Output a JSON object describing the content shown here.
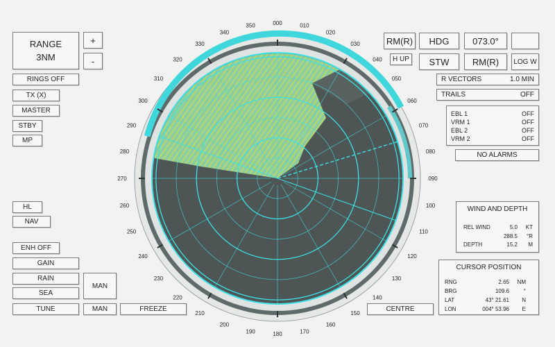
{
  "left": {
    "range_label": "RANGE",
    "range_value": "3NM",
    "plus": "+",
    "minus": "-",
    "rings": "RINGS OFF",
    "tx": "TX (X)",
    "master": "MASTER",
    "stby": "STBY",
    "mp": "MP",
    "hl": "HL",
    "nav": "NAV",
    "enh": "ENH OFF",
    "gain": "GAIN",
    "rain": "RAIN",
    "sea": "SEA",
    "tune": "TUNE",
    "man1": "MAN",
    "man2": "MAN",
    "freeze": "FREEZE"
  },
  "top_right": {
    "rm_r": "RM(R)",
    "hdg": "HDG",
    "hdg_value": "073.0°",
    "h_up": "H UP",
    "stw": "STW",
    "rm_r2": "RM(R)",
    "log_w": "LOG W"
  },
  "right": {
    "r_vectors_label": "R VECTORS",
    "r_vectors_value": "1.0 MIN",
    "trails_label": "TRAILS",
    "trails_value": "OFF",
    "markers": [
      {
        "label": "EBL 1",
        "value": "OFF"
      },
      {
        "label": "VRM 1",
        "value": "OFF"
      },
      {
        "label": "EBL 2",
        "value": "OFF"
      },
      {
        "label": "VRM 2",
        "value": "OFF"
      }
    ],
    "alarms": "NO ALARMS",
    "wind": {
      "title": "WIND AND DEPTH",
      "rel_wind_label": "REL WIND",
      "rel_wind_value": "5.0",
      "rel_wind_unit": "KT",
      "rel_wind_dir": "288.5",
      "rel_wind_dir_unit": "°R",
      "depth_label": "DEPTH",
      "depth_value": "15.2",
      "depth_unit": "M"
    },
    "cursor": {
      "title": "CURSOR POSITION",
      "rows": [
        {
          "label": "RNG",
          "value": "2.65",
          "unit": "NM"
        },
        {
          "label": "BRG",
          "value": "109.6",
          "unit": "°"
        },
        {
          "label": "LAT",
          "value": "43° 21.61",
          "unit": "N"
        },
        {
          "label": "LON",
          "value": "004° 53.96",
          "unit": "E"
        }
      ]
    },
    "centre": "CENTRE"
  },
  "radar": {
    "bearing_labels": [
      "000",
      "010",
      "020",
      "030",
      "040",
      "050",
      "060",
      "070",
      "080",
      "090",
      "100",
      "110",
      "120",
      "130",
      "140",
      "150",
      "160",
      "170",
      "180",
      "190",
      "200",
      "210",
      "220",
      "230",
      "240",
      "250",
      "260",
      "270",
      "280",
      "290",
      "300",
      "310",
      "320",
      "330",
      "340",
      "350"
    ],
    "heading_deg": 73.0,
    "cursor_bearing_deg": 109.6,
    "colors": {
      "scope": "#4d5654",
      "rings": "#3ee0e6",
      "echo": "#c9e34a",
      "bezel": "#5f6b6a"
    }
  }
}
